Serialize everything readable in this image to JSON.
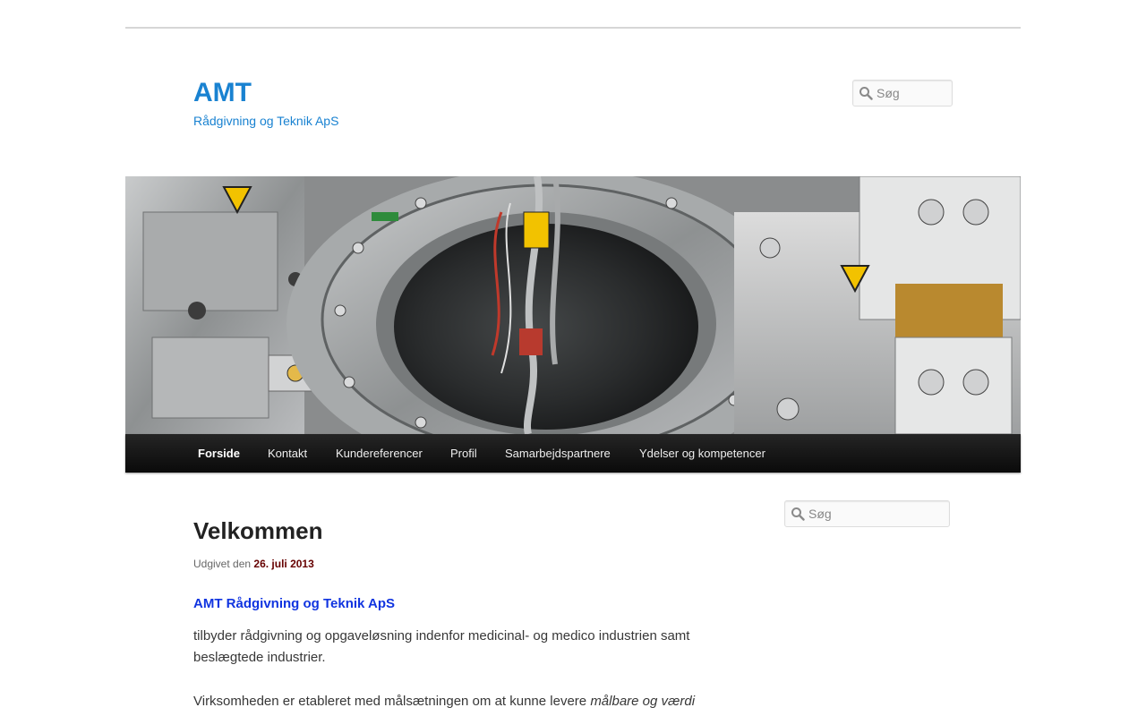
{
  "site": {
    "title": "AMT",
    "description": "Rådgivning og Teknik ApS"
  },
  "header_search": {
    "placeholder": "Søg"
  },
  "banner": {
    "alt": "Maskinudstyr"
  },
  "nav": {
    "items": [
      {
        "label": "Forside",
        "active": true
      },
      {
        "label": "Kontakt",
        "active": false
      },
      {
        "label": "Kundereferencer",
        "active": false
      },
      {
        "label": "Profil",
        "active": false
      },
      {
        "label": "Samarbejdspartnere",
        "active": false
      },
      {
        "label": "Ydelser og kompetencer",
        "active": false
      }
    ]
  },
  "sidebar_search": {
    "placeholder": "Søg"
  },
  "post": {
    "title": "Velkommen",
    "meta_prefix": "Udgivet den",
    "date": "26. juli 2013",
    "subheading": "AMT Rådgivning og Teknik ApS",
    "paragraph1": "tilbyder rådgivning og opgaveløsning indenfor medicinal- og medico industrien samt beslægtede industrier.",
    "paragraph2_text": "Virksomheden er etableret med målsætningen om at kunne levere",
    "paragraph2_em": "målbare og værdi"
  },
  "colors": {
    "link": "#1982d1",
    "nav_bg": "#222222",
    "date": "#660000",
    "subheading": "#1034e0"
  },
  "icons": [
    "search-icon",
    "banner-photo"
  ]
}
